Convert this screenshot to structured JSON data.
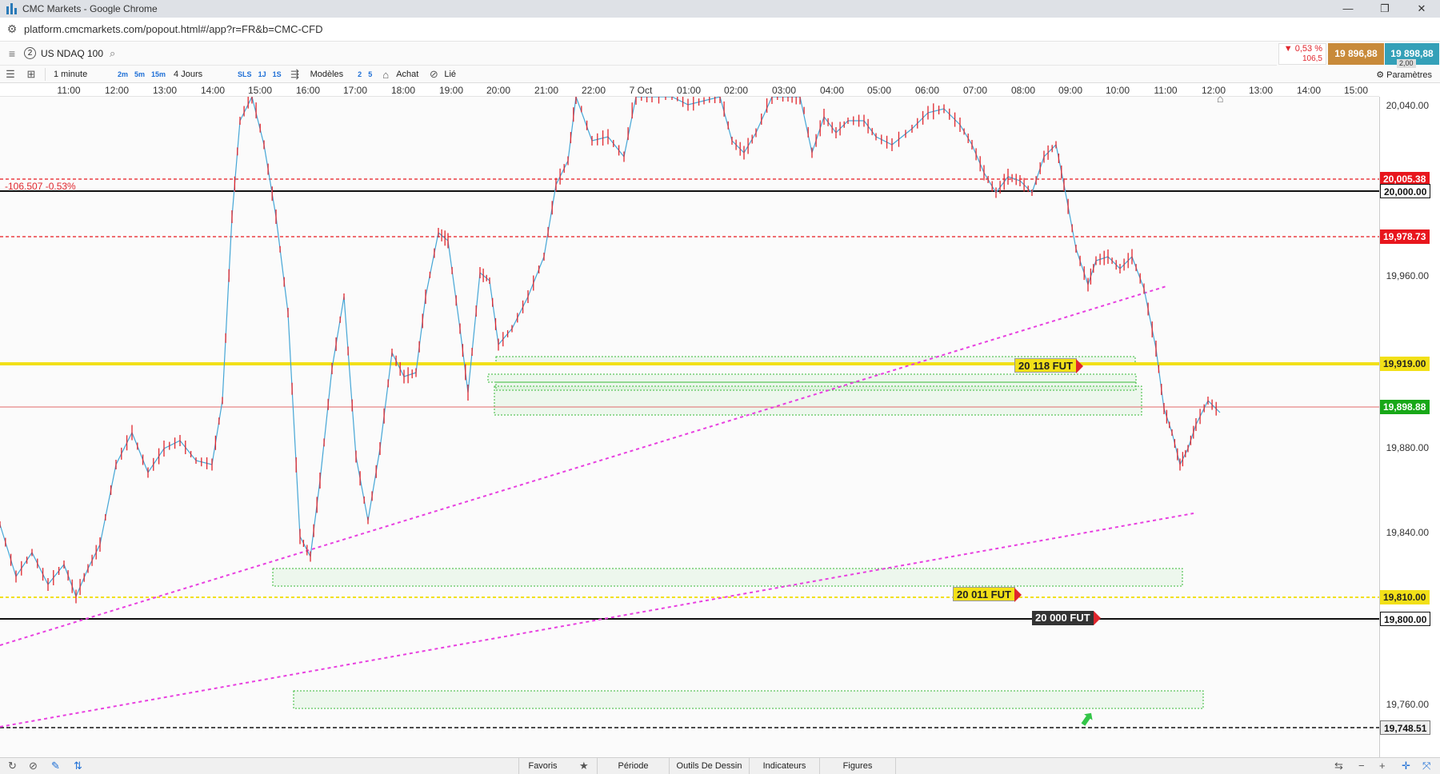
{
  "window": {
    "title": "CMC Markets - Google Chrome",
    "url": "platform.cmcmarkets.com/popout.html#/app?r=FR&b=CMC-CFD"
  },
  "instrument": {
    "badge": "2",
    "name": "US NDAQ 100",
    "change_pct": "0,53 %",
    "change_pts": "106,5",
    "sell": "19 896,88",
    "buy": "19 898,88",
    "spread": "2,00"
  },
  "toolbar": {
    "interval": "1 minute",
    "intervals_quick": [
      "2m",
      "5m",
      "15m"
    ],
    "range": "4 Jours",
    "tags": [
      "SLS",
      "1J",
      "1S"
    ],
    "models": "Modèles",
    "counts": [
      "2",
      "5"
    ],
    "buy_label": "Achat",
    "linked": "Lié",
    "params": "Paramètres"
  },
  "time_axis": [
    "11:00",
    "12:00",
    "13:00",
    "14:00",
    "15:00",
    "16:00",
    "17:00",
    "18:00",
    "19:00",
    "20:00",
    "21:00",
    "22:00",
    "7 Oct",
    "01:00",
    "02:00",
    "03:00",
    "04:00",
    "05:00",
    "06:00",
    "07:00",
    "08:00",
    "09:00",
    "10:00",
    "11:00",
    "12:00",
    "13:00",
    "14:00",
    "15:00"
  ],
  "price_ticks": [
    "20,040.00",
    "19,960.00",
    "19,880.00",
    "19,840.00",
    "19,760.00"
  ],
  "price_tags": {
    "prev_close": "20,005.38",
    "level_20000": "20,000.00",
    "red_level": "19,978.73",
    "yellow_level": "19,919.00",
    "current": "19,898.88",
    "yellow_dashed": "19,810.00",
    "level_19800": "19,800.00",
    "black_dashed": "19,748.51"
  },
  "chart_labels": {
    "change": "-106.507 -0.53%",
    "fut_20118": "20 118 FUT",
    "fut_20011": "20 011 FUT",
    "fut_20000": "20 000 FUT"
  },
  "colors": {
    "up": "#45a6d6",
    "down": "#e0262d",
    "yellow": "#f2e018",
    "magenta": "#e840e0",
    "current_tag": "#18a818"
  },
  "bottom_tabs": [
    "Favoris",
    "Période",
    "Outils De Dessin",
    "Indicateurs",
    "Figures"
  ]
}
